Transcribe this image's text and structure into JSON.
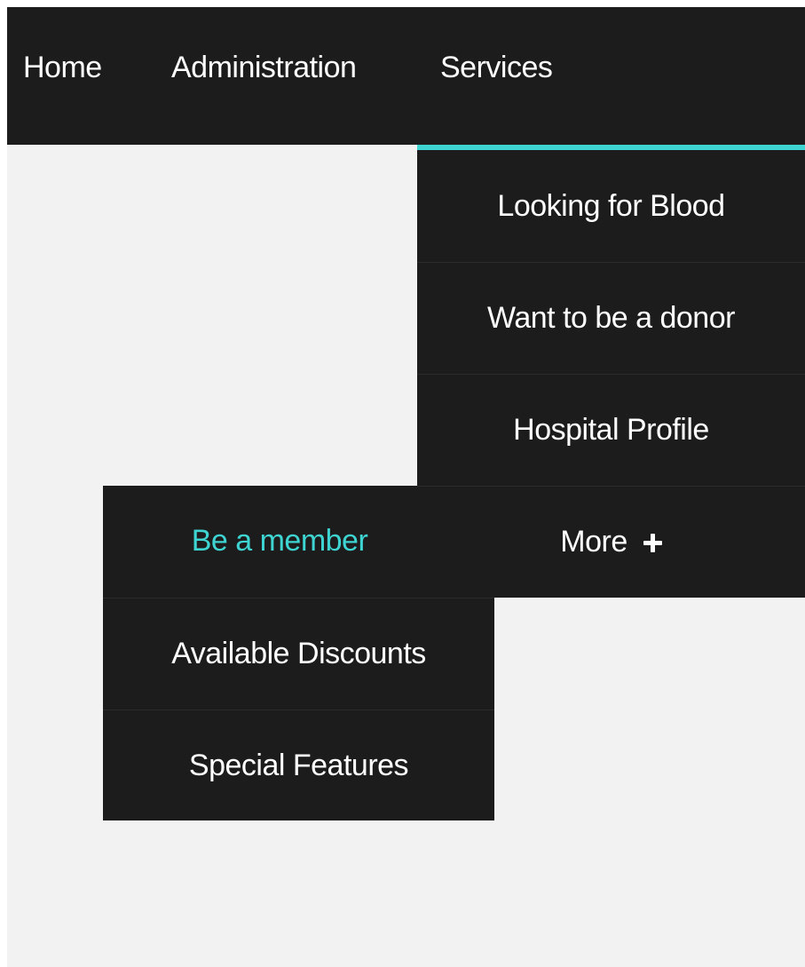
{
  "nav": {
    "home": "Home",
    "administration": "Administration",
    "services": "Services"
  },
  "services_menu": {
    "items": [
      "Looking for Blood",
      "Want to be a donor",
      "Hospital Profile"
    ],
    "more_label": "More"
  },
  "more_menu": {
    "items": [
      "Be a member",
      "Available Discounts",
      "Special Features"
    ],
    "active_item": "Be a member"
  },
  "colors": {
    "bar_background": "#1c1c1c",
    "page_background": "#f2f2f2",
    "accent": "#3ed4d2",
    "text": "#ffffff"
  },
  "icons": {
    "more_toggle": "plus-icon"
  }
}
